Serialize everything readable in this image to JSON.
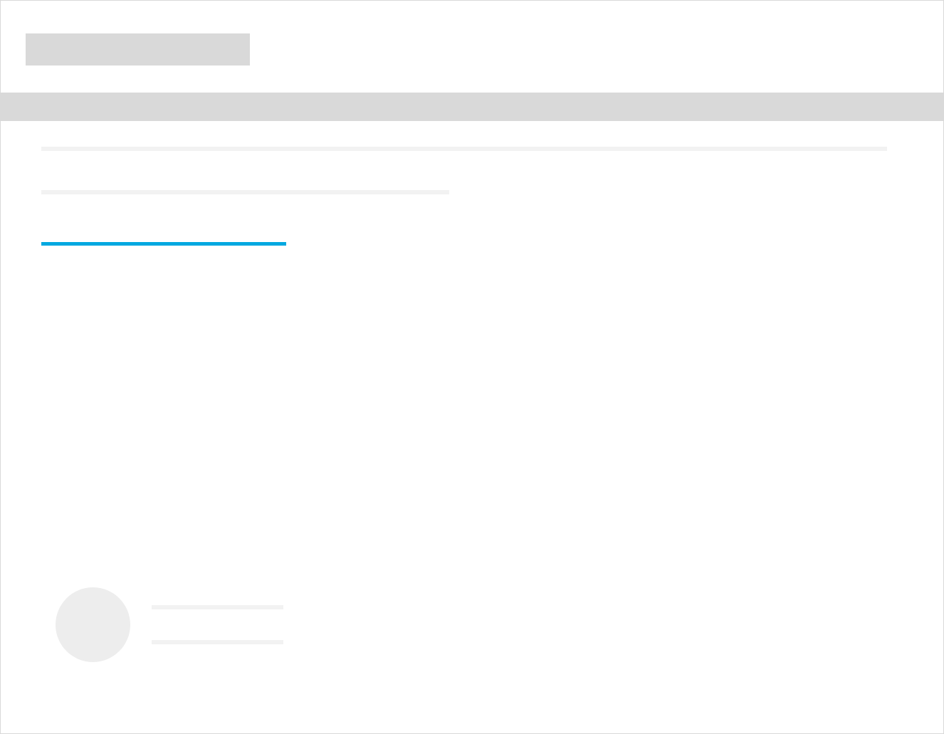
{
  "screen": {
    "kind": "skeleton"
  }
}
